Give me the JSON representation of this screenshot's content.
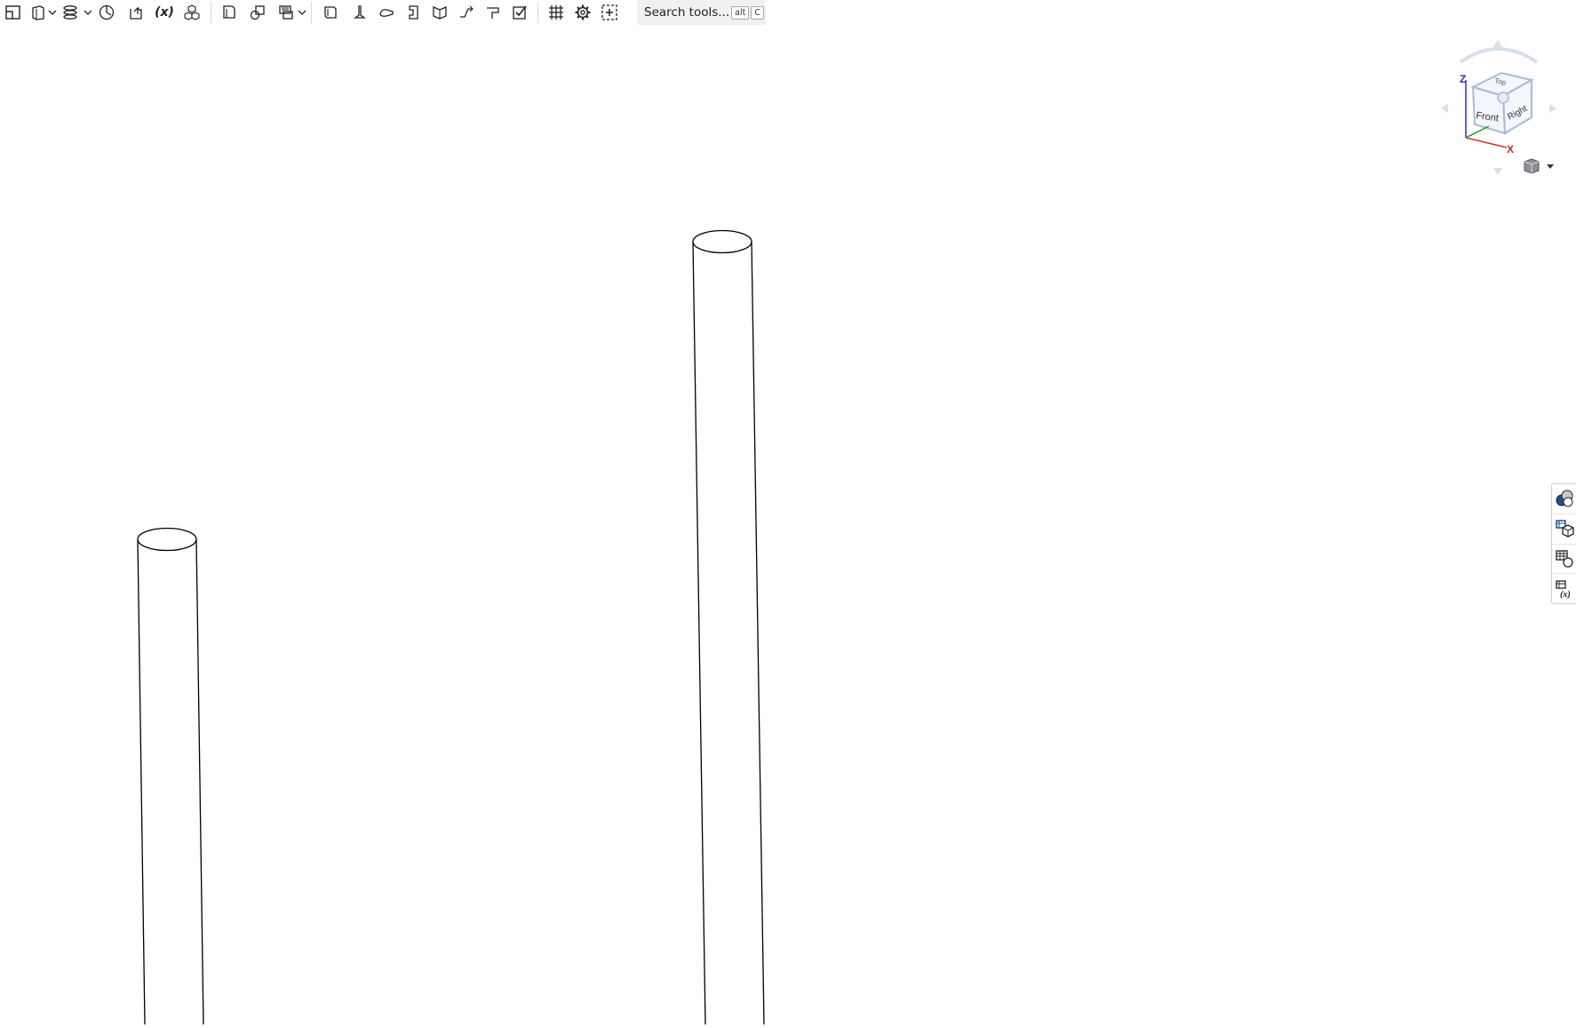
{
  "toolbar": {
    "group1": [
      {
        "name": "sketch-icon"
      },
      {
        "name": "extrude-icon",
        "has_dropdown": true
      },
      {
        "name": "sweep-icon",
        "has_dropdown": true
      },
      {
        "name": "revolve-icon"
      },
      {
        "name": "import-icon"
      },
      {
        "name": "variable-icon",
        "label": "(x)"
      },
      {
        "name": "pattern-icon"
      }
    ],
    "group2": [
      {
        "name": "fillet-icon"
      },
      {
        "name": "boolean-icon"
      },
      {
        "name": "transform-icon",
        "has_dropdown": true
      }
    ],
    "group3": [
      {
        "name": "sheet-metal-icon"
      },
      {
        "name": "flange-icon"
      },
      {
        "name": "hem-icon"
      },
      {
        "name": "tab-icon"
      },
      {
        "name": "bend-icon"
      },
      {
        "name": "jog-icon"
      },
      {
        "name": "corner-icon"
      },
      {
        "name": "finish-icon"
      }
    ],
    "group4": [
      {
        "name": "grid-icon"
      },
      {
        "name": "gear-icon"
      },
      {
        "name": "add-custom-icon"
      }
    ],
    "search": {
      "label": "Search tools...",
      "key1": "alt",
      "key2": "C"
    }
  },
  "view_cube": {
    "front": "Front",
    "right": "Right",
    "top": "Top",
    "axis_z": "Z",
    "axis_x": "X",
    "colors": {
      "z_axis": "#2b2bd1",
      "x_axis": "#d12b2b",
      "y_axis": "#2b9a2b",
      "cube_edge": "#9fb2c8"
    }
  },
  "right_panel": [
    {
      "name": "appearance-panel-icon"
    },
    {
      "name": "parts-panel-icon"
    },
    {
      "name": "mass-properties-icon"
    },
    {
      "name": "variables-panel-icon"
    }
  ]
}
